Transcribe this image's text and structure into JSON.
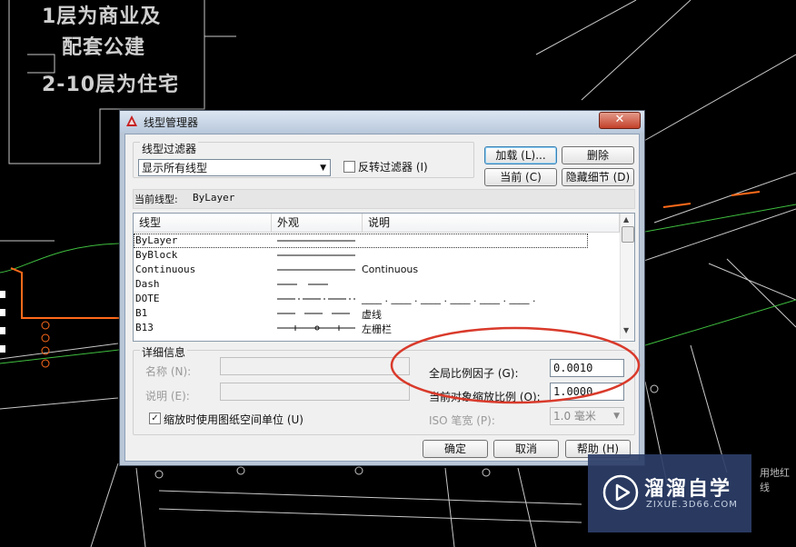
{
  "background": {
    "annotation_lines": [
      "1层为商业及",
      "配套公建",
      "2-10层为住宅"
    ],
    "right_edge_label": "用地红线"
  },
  "dialog": {
    "title": "线型管理器",
    "close_label": "✕",
    "filter": {
      "group_label": "线型过滤器",
      "selected": "显示所有线型",
      "invert_label": "反转过滤器 (I)",
      "invert_checked": false
    },
    "buttons": {
      "load": "加载 (L)...",
      "delete": "删除",
      "current": "当前 (C)",
      "hide_details": "隐藏细节 (D)",
      "ok": "确定",
      "cancel": "取消",
      "help": "帮助 (H)"
    },
    "current_linetype_label": "当前线型:",
    "current_linetype_value": "ByLayer",
    "list": {
      "headers": [
        "线型",
        "外观",
        "说明"
      ],
      "rows": [
        {
          "name": "ByLayer",
          "pattern": "solid",
          "description": ""
        },
        {
          "name": "ByBlock",
          "pattern": "solid",
          "description": ""
        },
        {
          "name": "Continuous",
          "pattern": "solid",
          "description": "Continuous"
        },
        {
          "name": "Dash",
          "pattern": "dash",
          "description": ""
        },
        {
          "name": "DOTE",
          "pattern": "dashdot",
          "description": "____ . ____ . ____ . ____ . ____ . ____ ."
        },
        {
          "name": "B1",
          "pattern": "longdash",
          "description": "虚线"
        },
        {
          "name": "B13",
          "pattern": "fence",
          "description": "左栅栏"
        }
      ]
    },
    "details": {
      "group_label": "详细信息",
      "name_label": "名称 (N):",
      "name_value": "",
      "description_label": "说明 (E):",
      "description_value": "",
      "paper_space_label": "缩放时使用图纸空间单位 (U)",
      "paper_space_checked": true,
      "global_scale_label": "全局比例因子 (G):",
      "global_scale_value": "0.0010",
      "current_scale_label": "当前对象缩放比例 (O):",
      "current_scale_value": "1.0000",
      "iso_pen_label": "ISO 笔宽 (P):",
      "iso_pen_value": "1.0 毫米"
    }
  },
  "watermark": {
    "name": "溜溜自学",
    "url": "ZIXUE.3D66.COM"
  },
  "colors": {
    "highlight_ellipse": "#d93a2b",
    "cad_orange": "#ff6a1a",
    "cad_green": "#3fbf3f"
  }
}
